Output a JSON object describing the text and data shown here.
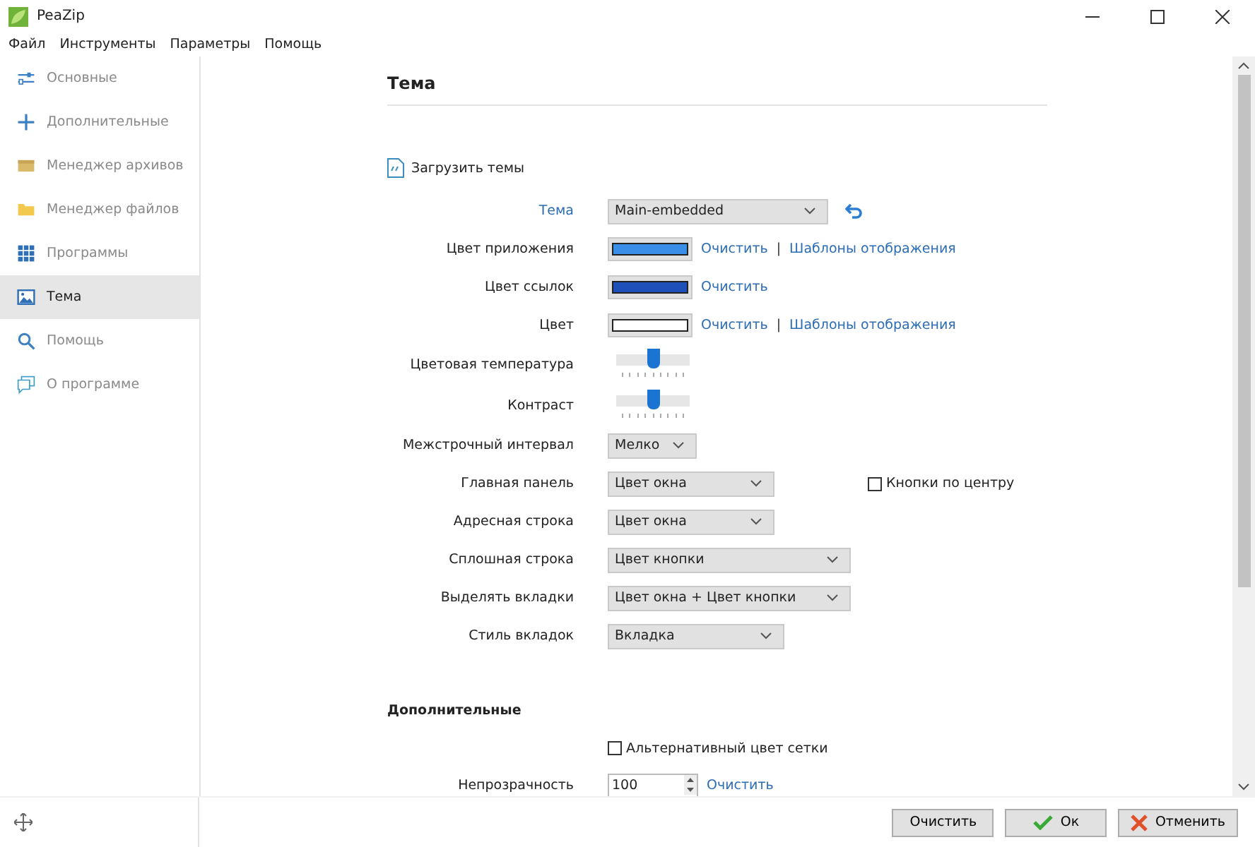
{
  "window": {
    "title": "PeaZip"
  },
  "menu": [
    "Файл",
    "Инструменты",
    "Параметры",
    "Помощь"
  ],
  "sidebar": {
    "items": [
      {
        "label": "Основные",
        "selected": false
      },
      {
        "label": "Дополнительные",
        "selected": false
      },
      {
        "label": "Менеджер архивов",
        "selected": false
      },
      {
        "label": "Менеджер файлов",
        "selected": false
      },
      {
        "label": "Программы",
        "selected": false
      },
      {
        "label": "Тема",
        "selected": true
      },
      {
        "label": "Помощь",
        "selected": false
      },
      {
        "label": "О программе",
        "selected": false
      }
    ]
  },
  "page": {
    "title": "Тема",
    "load_link": "Загрузить темы",
    "rows": [
      {
        "kind": "dropdown",
        "label": "Тема",
        "label_link": true,
        "value": "Main-embedded",
        "reset": true
      },
      {
        "kind": "color",
        "label": "Цвет приложения",
        "color": "#3a8ee6",
        "links": [
          {
            "kind": "link",
            "text": "Очистить"
          },
          {
            "kind": "separator",
            "text": "|"
          },
          {
            "kind": "link",
            "text": "Шаблоны отображения"
          }
        ]
      },
      {
        "kind": "color",
        "label": "Цвет ссылок",
        "color": "#1f4fb8",
        "links": [
          {
            "kind": "link",
            "text": "Очистить"
          }
        ]
      },
      {
        "kind": "color",
        "label": "Цвет",
        "color": "#ffffff",
        "links": [
          {
            "kind": "link",
            "text": "Очистить"
          },
          {
            "kind": "separator",
            "text": "|"
          },
          {
            "kind": "link",
            "text": "Шаблоны отображения"
          }
        ]
      },
      {
        "kind": "slider",
        "label": "Цветовая температура",
        "level": 0.5
      },
      {
        "kind": "slider",
        "label": "Контраст",
        "level": 0.5
      },
      {
        "kind": "dropdown",
        "label": "Межстрочный интервал",
        "value": "Мелко"
      },
      {
        "kind": "dropdown",
        "label": "Главная панель",
        "value": "Цвет окна",
        "checkbox": {
          "label": "Кнопки по центру",
          "checked": false
        }
      },
      {
        "kind": "dropdown",
        "label": "Адресная строка",
        "value": "Цвет окна"
      },
      {
        "kind": "dropdown",
        "label": "Сплошная строка",
        "value": "Цвет кнопки"
      },
      {
        "kind": "dropdown",
        "label": "Выделять вкладки",
        "value": "Цвет окна + Цвет кнопки"
      },
      {
        "kind": "dropdown",
        "label": "Стиль вкладок",
        "value": "Вкладка"
      }
    ],
    "section": "Дополнительные",
    "extra_rows": [
      {
        "kind": "checkbox",
        "label": "Альтернативный цвет сетки",
        "checked": false
      },
      {
        "kind": "spinner",
        "label": "Непрозрачность",
        "value": "100",
        "links": [
          "Очистить"
        ]
      }
    ]
  },
  "buttons": [
    {
      "label": "Очистить",
      "kind": "plain"
    },
    {
      "label": "Ок",
      "kind": "ok"
    },
    {
      "label": "Отменить",
      "kind": "cancel"
    }
  ]
}
